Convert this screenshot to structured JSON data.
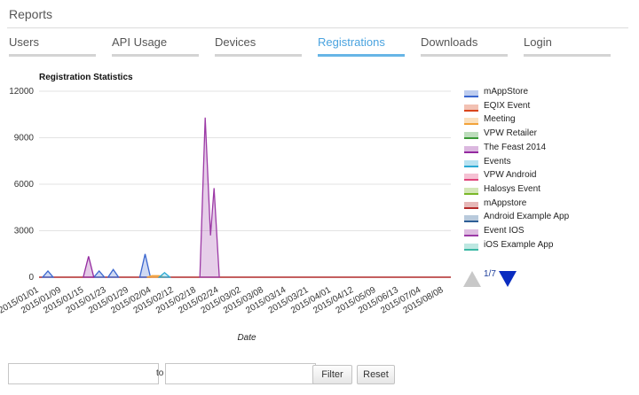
{
  "page": {
    "title": "Reports"
  },
  "tabs": [
    {
      "label": "Users",
      "active": false
    },
    {
      "label": "API Usage",
      "active": false
    },
    {
      "label": "Devices",
      "active": false
    },
    {
      "label": "Registrations",
      "active": true
    },
    {
      "label": "Downloads",
      "active": false
    },
    {
      "label": "Login",
      "active": false
    }
  ],
  "legend": {
    "pager_text": "1/7",
    "items": [
      {
        "label": "mAppStore",
        "color": "#3a66cf"
      },
      {
        "label": "EQIX Event",
        "color": "#d9461c"
      },
      {
        "label": "Meeting",
        "color": "#f2a33a"
      },
      {
        "label": "VPW Retailer",
        "color": "#3a9a36"
      },
      {
        "label": "The Feast 2014",
        "color": "#942aa0"
      },
      {
        "label": "Events",
        "color": "#29a9d4"
      },
      {
        "label": "VPW Android",
        "color": "#e0447a"
      },
      {
        "label": "Halosys Event",
        "color": "#7ab828"
      },
      {
        "label": "mAppstore",
        "color": "#b52a2a"
      },
      {
        "label": "Android Example App",
        "color": "#2e5f96"
      },
      {
        "label": "Event IOS",
        "color": "#9c3aa6"
      },
      {
        "label": "iOS Example App",
        "color": "#3ab8a4"
      }
    ]
  },
  "chart_data": {
    "type": "area",
    "title": "Registration Statistics",
    "xlabel": "Date",
    "ylabel": "",
    "ylim": [
      0,
      12000
    ],
    "yticks": [
      0,
      3000,
      6000,
      9000,
      12000
    ],
    "grid": true,
    "legend_position": "right",
    "x_range": [
      "2015-01-01",
      "2015-08-22"
    ],
    "x_tick_labels": [
      "2015/01/01",
      "2015/01/09",
      "2015/01/15",
      "2015/01/23",
      "2015/01/29",
      "2015/02/04",
      "2015/02/12",
      "2015/02/18",
      "2015/02/24",
      "2015/03/02",
      "2015/03/08",
      "2015/03/14",
      "2015/03/21",
      "2015/04/01",
      "2015/04/12",
      "2015/05/09",
      "2015/06/13",
      "2015/07/04",
      "2015/08/08"
    ],
    "series": [
      {
        "name": "mAppStore",
        "points": [
          [
            "2015-01-06",
            400
          ],
          [
            "2015-02-04",
            400
          ],
          [
            "2015-02-12",
            500
          ],
          [
            "2015-03-02",
            1500
          ]
        ]
      },
      {
        "name": "The Feast 2014",
        "points": [
          [
            "2015-01-29",
            1350
          ]
        ]
      },
      {
        "name": "Meeting",
        "points": [
          [
            "2015-03-06",
            100
          ],
          [
            "2015-03-10",
            100
          ]
        ]
      },
      {
        "name": "Events",
        "points": [
          [
            "2015-03-13",
            300
          ]
        ]
      },
      {
        "name": "Event IOS",
        "points": [
          [
            "2015-04-05",
            10300
          ],
          [
            "2015-04-08",
            2700
          ],
          [
            "2015-04-10",
            5750
          ]
        ]
      }
    ]
  },
  "filters": {
    "from_value": "",
    "from_placeholder": "",
    "to_label": "to",
    "to_value": "",
    "to_placeholder": "",
    "filter_label": "Filter",
    "reset_label": "Reset"
  }
}
